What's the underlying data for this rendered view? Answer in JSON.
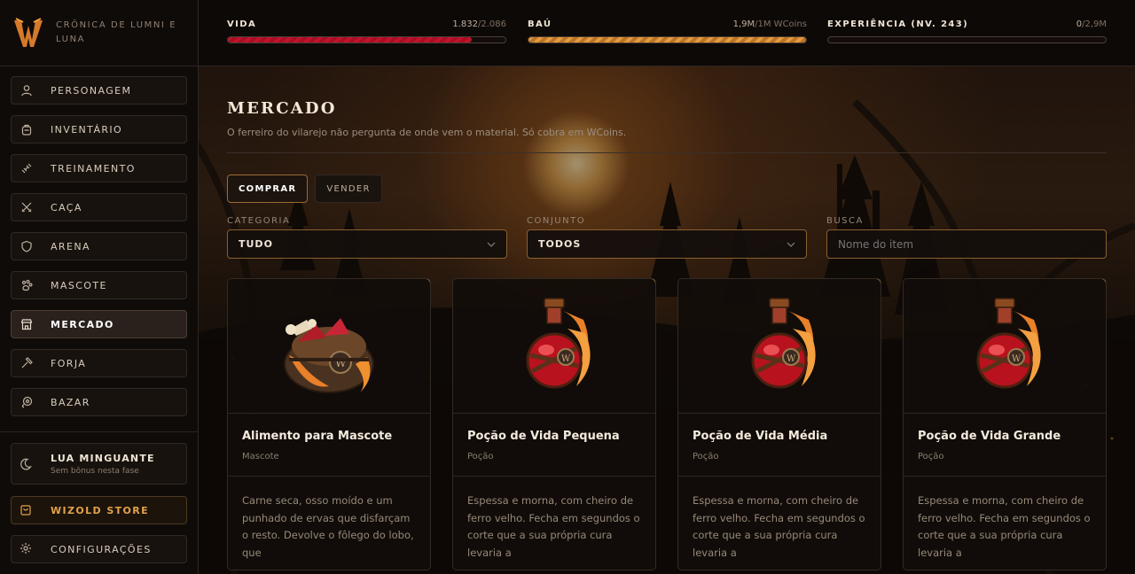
{
  "brand": {
    "name": "Crônica de Lumni e Luna"
  },
  "stats": [
    {
      "label": "VIDA",
      "value": "1.832",
      "max": "/2.086",
      "fill": 0.878,
      "color": "red"
    },
    {
      "label": "BAÚ",
      "value": "1,9M",
      "max": "/1M WCoins",
      "fill": 1.0,
      "color": "gold"
    },
    {
      "label": "EXPERIÊNCIA (NV. 243)",
      "value": "0",
      "max": "/2,9M",
      "fill": 0.0,
      "color": "gold"
    }
  ],
  "sidebar": {
    "items": [
      {
        "label": "PERSONAGEM",
        "icon": "user-icon"
      },
      {
        "label": "INVENTÁRIO",
        "icon": "backpack-icon"
      },
      {
        "label": "TREINAMENTO",
        "icon": "dumbbell-icon"
      },
      {
        "label": "CAÇA",
        "icon": "crossed-swords-icon"
      },
      {
        "label": "ARENA",
        "icon": "shield-icon"
      },
      {
        "label": "MASCOTE",
        "icon": "paw-icon"
      },
      {
        "label": "MERCADO",
        "icon": "store-icon",
        "active": true
      },
      {
        "label": "FORJA",
        "icon": "hammer-icon"
      },
      {
        "label": "BAZAR",
        "icon": "coins-icon"
      }
    ],
    "moon": {
      "title": "LUA MINGUANTE",
      "subtitle": "Sem bônus nesta fase"
    },
    "store": {
      "label": "WIZOLD STORE"
    },
    "settings": {
      "label": "CONFIGURAÇÕES"
    }
  },
  "page": {
    "title": "MERCADO",
    "subtitle": "O ferreiro do vilarejo não pergunta de onde vem o material. Só cobra em WCoins."
  },
  "tabs": {
    "buy": "COMPRAR",
    "sell": "VENDER"
  },
  "filters": {
    "category_label": "CATEGORIA",
    "category_value": "TUDO",
    "set_label": "CONJUNTO",
    "set_value": "TODOS",
    "search_label": "BUSCA",
    "search_placeholder": "Nome do item"
  },
  "items": [
    {
      "name": "Alimento para Mascote",
      "type": "Mascote",
      "icon": "pet-food-bag-icon",
      "desc": "Carne seca, osso moído e um punhado de ervas que disfarçam o resto. Devolve o fôlego do lobo, que"
    },
    {
      "name": "Poção de Vida Pequena",
      "type": "Poção",
      "icon": "health-potion-icon",
      "desc": "Espessa e morna, com cheiro de ferro velho. Fecha em segundos o corte que a sua própria cura levaria a"
    },
    {
      "name": "Poção de Vida Média",
      "type": "Poção",
      "icon": "health-potion-icon",
      "desc": "Espessa e morna, com cheiro de ferro velho. Fecha em segundos o corte que a sua própria cura levaria a"
    },
    {
      "name": "Poção de Vida Grande",
      "type": "Poção",
      "icon": "health-potion-icon",
      "desc": "Espessa e morna, com cheiro de ferro velho. Fecha em segundos o corte que a sua própria cura levaria a"
    }
  ],
  "colors": {
    "accent": "#e3a24a",
    "health": "#c4122c",
    "gold": "#e69a3a",
    "background": "#0d0907"
  }
}
